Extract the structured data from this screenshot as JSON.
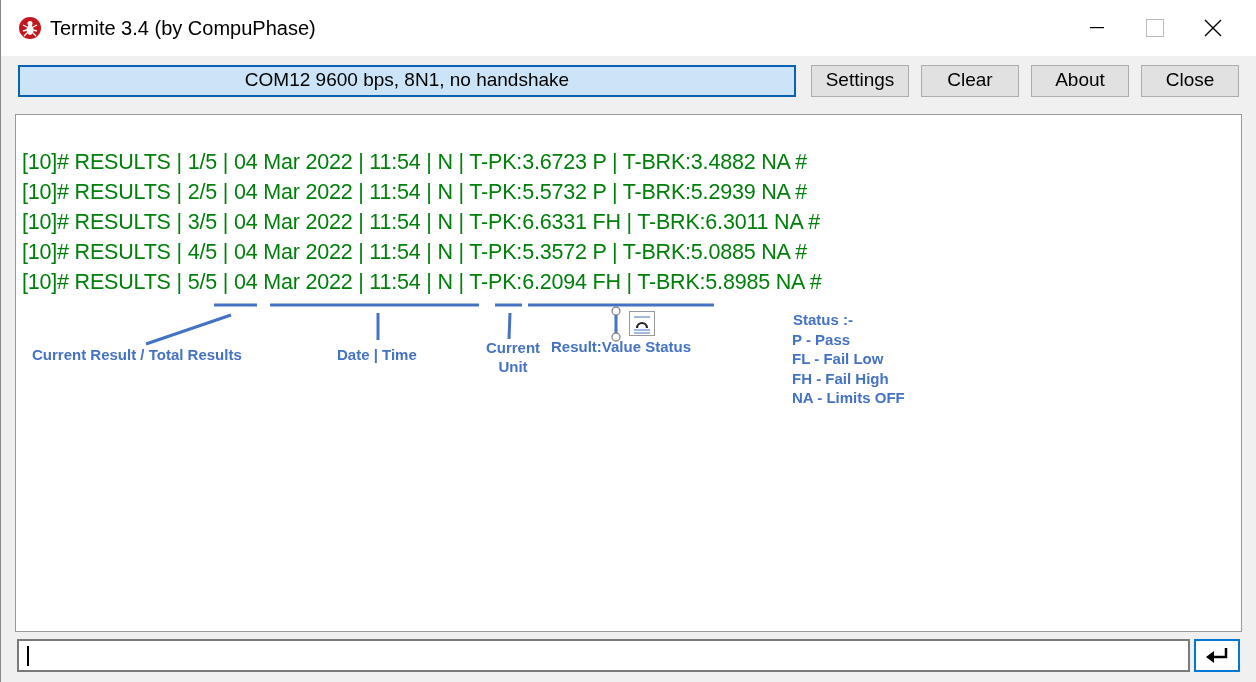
{
  "window": {
    "title": "Termite 3.4 (by CompuPhase)"
  },
  "status": {
    "text": "COM12 9600 bps, 8N1, no handshake"
  },
  "buttons": [
    "Settings",
    "Clear",
    "About",
    "Close"
  ],
  "terminal": {
    "lines": [
      "[10]# RESULTS | 1/5 | 04 Mar 2022 | 11:54 | N | T-PK:3.6723 P | T-BRK:3.4882 NA #",
      "[10]# RESULTS | 2/5 | 04 Mar 2022 | 11:54 | N | T-PK:5.5732 P | T-BRK:5.2939 NA #",
      "[10]# RESULTS | 3/5 | 04 Mar 2022 | 11:54 | N | T-PK:6.6331 FH | T-BRK:6.3011 NA #",
      "[10]# RESULTS | 4/5 | 04 Mar 2022 | 11:54 | N | T-PK:5.3572 P | T-BRK:5.0885 NA #",
      "[10]# RESULTS | 5/5 | 04 Mar 2022 | 11:54 | N | T-PK:6.2094 FH | T-BRK:5.8985 NA #"
    ]
  },
  "annotations": {
    "labels": [
      "Current Result / Total Results",
      "Date | Time",
      "Current Unit",
      "Result:Value Status"
    ],
    "status_legend": [
      "Status :-",
      "P - Pass",
      "FL - Fail Low",
      "FH - Fail High",
      "NA - Limits OFF"
    ]
  }
}
